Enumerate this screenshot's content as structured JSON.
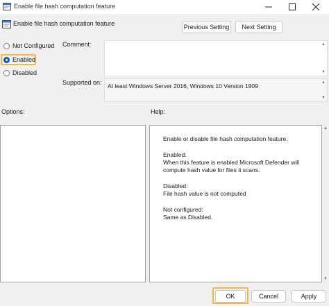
{
  "window": {
    "title": "Enable file hash computation feature",
    "icon": "policy-setting-icon"
  },
  "header": {
    "title": "Enable file hash computation feature",
    "icon": "policy-setting-icon",
    "previous_label": "Previous Setting",
    "next_label": "Next Setting"
  },
  "state": {
    "options": [
      {
        "label": "Not Configured",
        "selected": false
      },
      {
        "label": "Enabled",
        "selected": true
      },
      {
        "label": "Disabled",
        "selected": false
      }
    ]
  },
  "comment": {
    "label": "Comment:",
    "value": ""
  },
  "supported": {
    "label": "Supported on:",
    "value": "At least Windows Server 2016, Windows 10 Version 1909"
  },
  "sections": {
    "options_label": "Options:",
    "help_label": "Help:"
  },
  "help": {
    "lines": [
      "Enable or disable file hash computation feature.",
      "Enabled:",
      "When this feature is enabled Microsoft Defender will",
      "compute hash value for files it scans.",
      "Disabled:",
      "File hash value is not computed",
      "Not configured:",
      "Same as Disabled."
    ]
  },
  "footer": {
    "ok_label": "OK",
    "cancel_label": "Cancel",
    "apply_label": "Apply"
  },
  "colors": {
    "highlight": "#f0b84a",
    "radio_selected": "#0a5fb4"
  }
}
